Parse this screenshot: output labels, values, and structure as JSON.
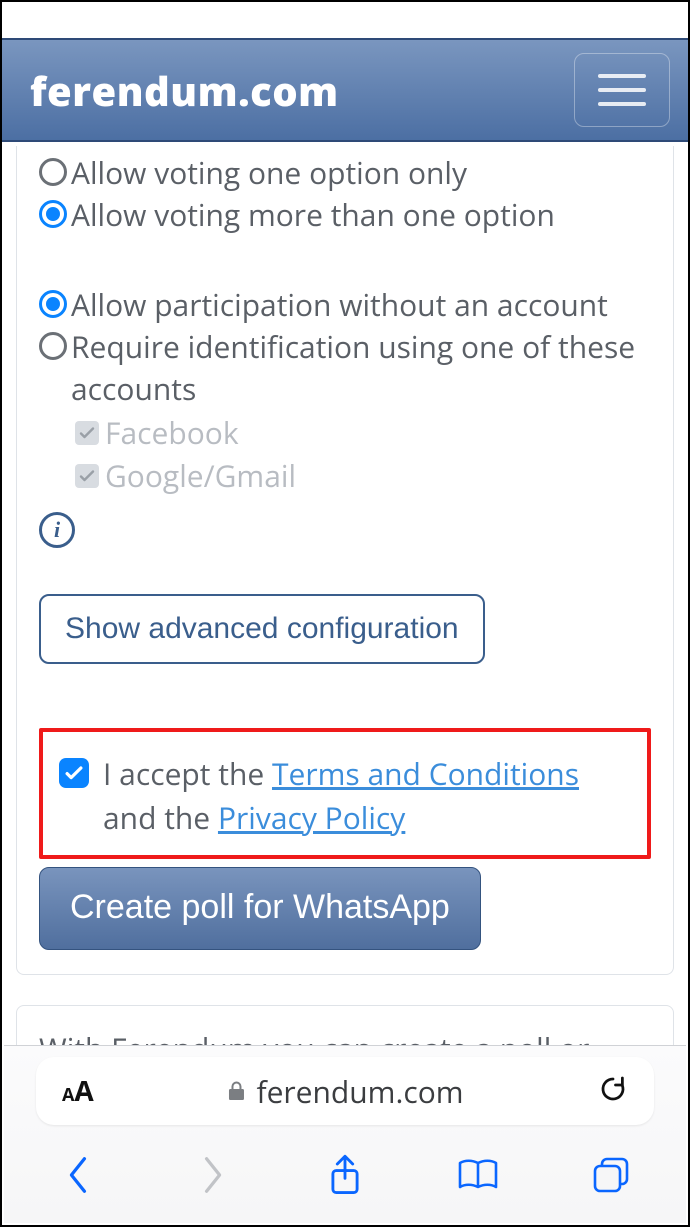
{
  "navbar": {
    "logo": "ferendum.com"
  },
  "voting_mode": {
    "options": [
      {
        "label": "Allow voting one option only",
        "selected": false
      },
      {
        "label": "Allow voting more than one option",
        "selected": true
      }
    ]
  },
  "participation": {
    "options": [
      {
        "label": "Allow participation without an account",
        "selected": true
      },
      {
        "label": "Require identification using one of these accounts",
        "selected": false
      }
    ],
    "accounts": [
      {
        "label": "Facebook"
      },
      {
        "label": "Google/Gmail"
      }
    ]
  },
  "buttons": {
    "advanced": "Show advanced configuration",
    "create": "Create poll for WhatsApp"
  },
  "terms": {
    "checked": true,
    "t1": "I accept the ",
    "link1": "Terms and Conditions",
    "t2": " and the ",
    "link2": "Privacy Policy"
  },
  "footer_card": "With Ferendum you can create a poll or",
  "browser": {
    "domain": "ferendum.com"
  }
}
